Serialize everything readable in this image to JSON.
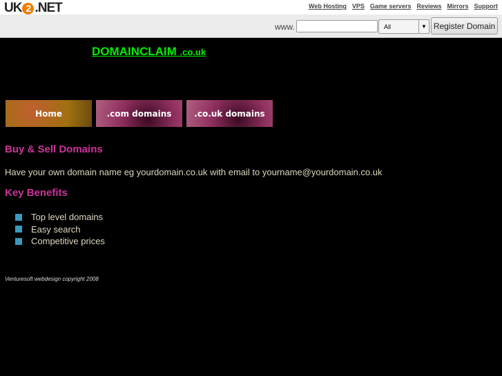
{
  "header": {
    "logo_pre": "UK",
    "logo_num": "2",
    "logo_post": ".NET",
    "links": [
      "Web Hosting",
      "VPS",
      "Game servers",
      "Reviews",
      "Mirrors",
      "Support"
    ]
  },
  "search": {
    "prefix": "www.",
    "value": "",
    "tld": "All",
    "button": "Register Domain"
  },
  "site": {
    "title": "DOMAINCLAIM",
    "suffix": ".co.uk"
  },
  "nav": [
    "Home",
    ".com domains",
    ".co.uk domains"
  ],
  "main": {
    "heading1": "Buy & Sell Domains",
    "intro": "Have your own domain name eg yourdomain.co.uk with email to yourname@yourdomain.co.uk",
    "heading2": "Key Benefits",
    "benefits": [
      "Top level domains",
      "Easy search",
      "Competitive prices"
    ]
  },
  "footer": "Venturesoft webdesign  copyright 2008"
}
